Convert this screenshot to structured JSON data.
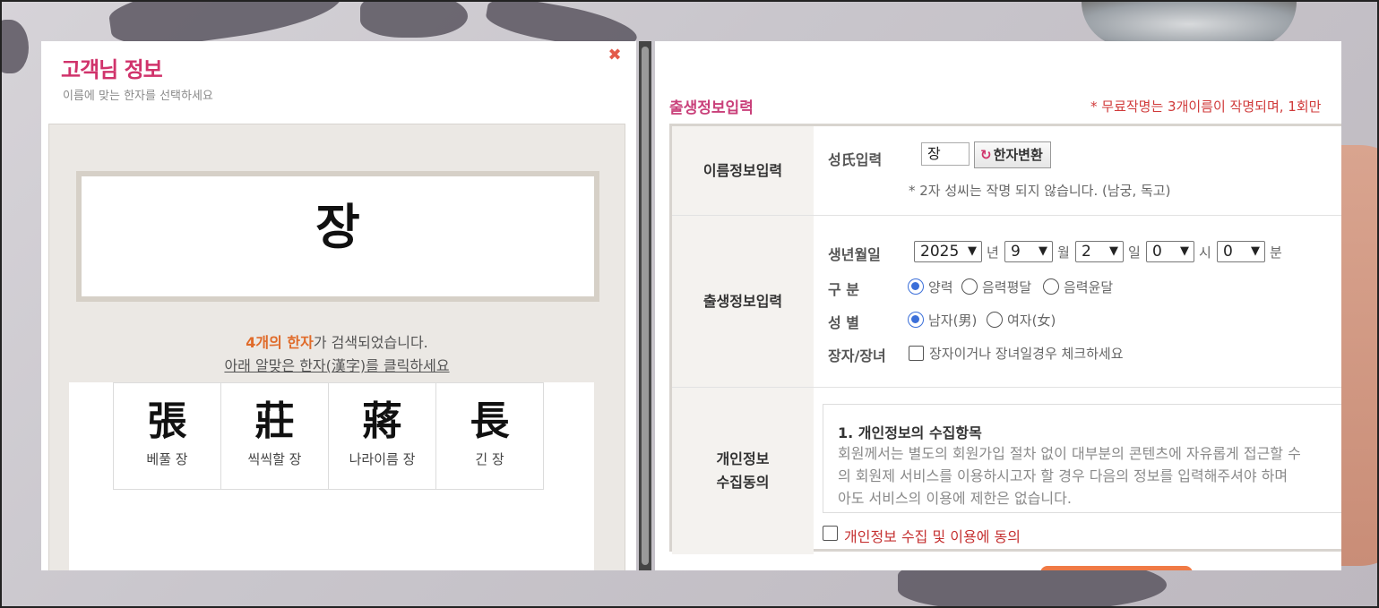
{
  "left": {
    "title_highlight": "고객님",
    "title_rest": " 정보",
    "subtitle": "이름에 맞는 한자를 선택하세요",
    "close_icon": "✖",
    "name": "장",
    "count_highlight": "4개의 한자",
    "count_rest": "가 검색되었습니다.",
    "click_instruction": "아래 알맞은 한자(漢字)를 클릭하세요",
    "hanja": [
      {
        "char": "張",
        "reading": "베풀 장"
      },
      {
        "char": "莊",
        "reading": "씩씩할 장"
      },
      {
        "char": "蔣",
        "reading": "나라이름 장"
      },
      {
        "char": "長",
        "reading": "긴 장"
      }
    ]
  },
  "right": {
    "section_title": "출생정보입력",
    "notice": "* 무료작명는 3개이름이 작명되며, 1회만",
    "name_row": {
      "label": "이름정보입력",
      "surname_label": "성氏입력",
      "surname_value": "장",
      "convert_icon": "↻",
      "convert_button": "한자변환",
      "note": "* 2자 성씨는 작명 되지 않습니다. (남궁, 독고)"
    },
    "birth_row": {
      "label": "출생정보입력",
      "birth_label": "생년월일",
      "year": "2025",
      "year_unit": "년",
      "month": "9",
      "month_unit": "월",
      "day": "2",
      "day_unit": "일",
      "hour": "0",
      "hour_unit": "시",
      "minute": "0",
      "minute_unit": "분",
      "calendar_label": "구 분",
      "calendar_options": [
        "양력",
        "음력평달",
        "음력윤달"
      ],
      "calendar_selected": "양력",
      "gender_label": "성 별",
      "gender_options": [
        "남자(男)",
        "여자(女)"
      ],
      "gender_selected": "남자(男)",
      "eldest_label": "장자/장녀",
      "eldest_text": "장자이거나 장녀일경우 체크하세요"
    },
    "consent_row": {
      "label_line1": "개인정보",
      "label_line2": "수집동의",
      "box_title": "1. 개인정보의 수집항목",
      "box_lines": [
        "회원께서는 별도의 회원가입 절차 없이 대부분의 콘텐츠에 자유롭게 접근할 수",
        "의 회원제 서비스를 이용하시고자 할 경우 다음의 정보를 입력해주셔야 하며",
        "아도 서비스의 이용에 제한은 없습니다."
      ],
      "agree_text": "개인정보 수집 및 이용에 동의"
    }
  },
  "colors": {
    "accent_pink": "#d0336b",
    "accent_orange": "#e06b2a",
    "radio_blue": "#3b6fd9",
    "notice_red": "#d03a3a"
  }
}
